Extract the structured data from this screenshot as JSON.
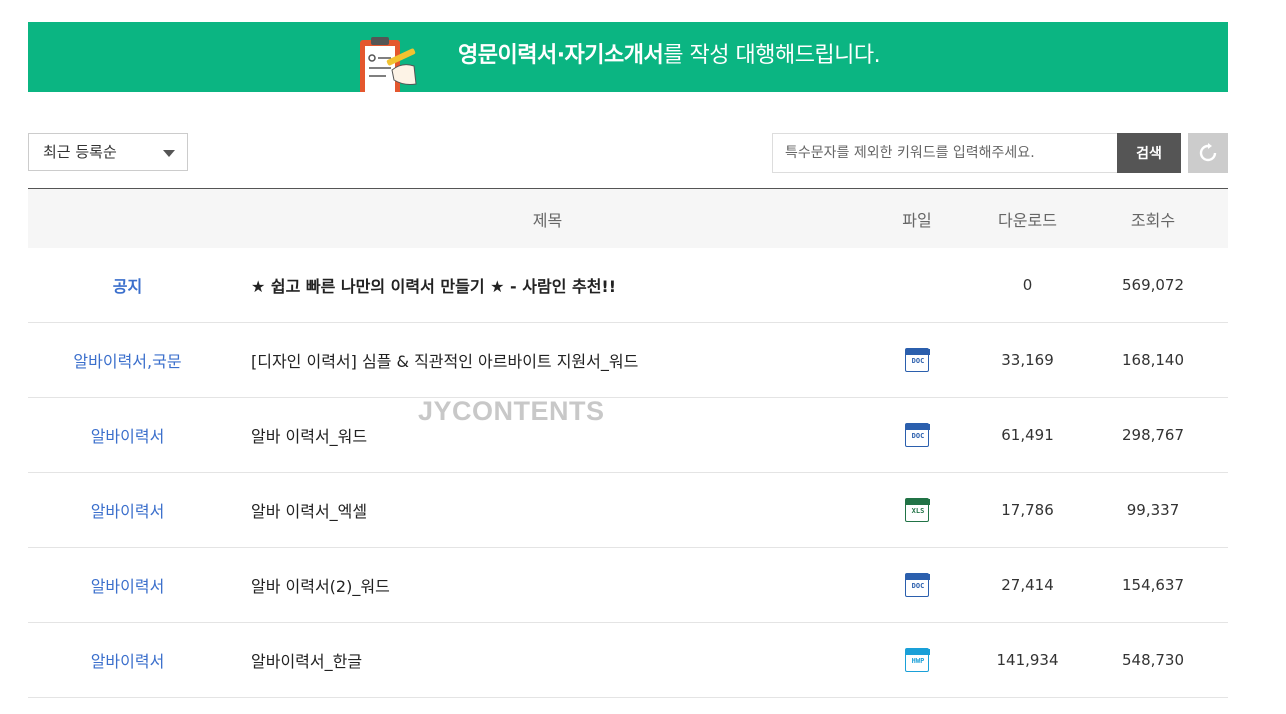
{
  "banner": {
    "highlight": "영문이력서·자기소개서",
    "rest": "를 작성 대행해드립니다."
  },
  "sort": {
    "label": "최근 등록순"
  },
  "search": {
    "placeholder": "특수문자를 제외한 키워드를 입력해주세요.",
    "button": "검색"
  },
  "table": {
    "headers": {
      "title": "제목",
      "file": "파일",
      "downloads": "다운로드",
      "views": "조회수"
    },
    "rows": [
      {
        "category": "공지",
        "title": "★ 쉽고 빠른 나만의 이력서 만들기 ★ - 사람인 추천!!",
        "file": "",
        "downloads": "0",
        "views": "569,072"
      },
      {
        "category": "알바이력서,국문",
        "title": "[디자인 이력서] 심플 & 직관적인 아르바이트 지원서_워드",
        "file": "doc",
        "downloads": "33,169",
        "views": "168,140"
      },
      {
        "category": "알바이력서",
        "title": "알바 이력서_워드",
        "file": "doc",
        "downloads": "61,491",
        "views": "298,767"
      },
      {
        "category": "알바이력서",
        "title": "알바 이력서_엑셀",
        "file": "xls",
        "downloads": "17,786",
        "views": "99,337"
      },
      {
        "category": "알바이력서",
        "title": "알바 이력서(2)_워드",
        "file": "doc",
        "downloads": "27,414",
        "views": "154,637"
      },
      {
        "category": "알바이력서",
        "title": "알바이력서_한글",
        "file": "hwp",
        "downloads": "141,934",
        "views": "548,730"
      }
    ]
  },
  "file_icons": {
    "doc": {
      "label": "DOC",
      "color": "#2b5fad"
    },
    "xls": {
      "label": "XLS",
      "color": "#217346"
    },
    "hwp": {
      "label": "HWP",
      "color": "#1aa0d8"
    }
  },
  "watermark": "JYCONTENTS",
  "colors": {
    "banner": "#0bb582",
    "category": "#3b6fcc"
  }
}
